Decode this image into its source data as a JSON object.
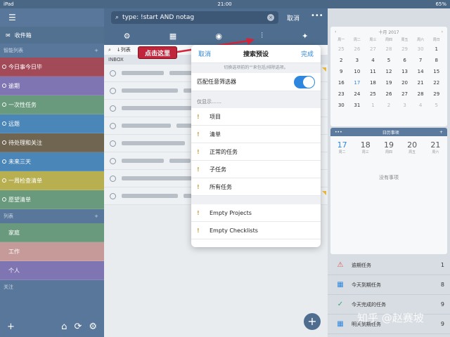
{
  "status": {
    "carrier": "iPad",
    "time": "21:00",
    "battery": "65%"
  },
  "sidebar": {
    "inbox_label": "收件箱",
    "smart_lists_title": "智能列表",
    "smart_lists": [
      {
        "label": "今日事今日毕",
        "color": "#a24a58"
      },
      {
        "label": "逾期",
        "color": "#7e75b2"
      },
      {
        "label": "一次性任务",
        "color": "#6a9a7d"
      },
      {
        "label": "远题",
        "color": "#4b86b8"
      },
      {
        "label": "待处理和关注",
        "color": "#6f6550"
      },
      {
        "label": "未来三天",
        "color": "#4b86b8"
      },
      {
        "label": "一周检查清单",
        "color": "#b8b050"
      },
      {
        "label": "愿望清单",
        "color": "#6a9a7d"
      }
    ],
    "lists_title": "列表",
    "lists": [
      {
        "label": "家庭",
        "color": "#6a9a7d"
      },
      {
        "label": "工作",
        "color": "#c79a9a"
      },
      {
        "label": "个人",
        "color": "#7e75b2"
      }
    ],
    "focus_title": "关注"
  },
  "search": {
    "query": "type: !start AND notag",
    "cancel_label": "取消"
  },
  "list": {
    "header_label": "↓列表",
    "inbox_label": "INBOX"
  },
  "callout": {
    "label": "点击这里"
  },
  "popover": {
    "cancel_label": "取消",
    "title": "搜索预设",
    "done_label": "完成",
    "hint": "切换选项前的\"\"来包括/排除选项。",
    "match_any_label": "匹配任意筛选器",
    "match_any_on": true,
    "show_only_title": "仅显示……",
    "options": [
      "项目",
      "清单",
      "正常的任务",
      "子任务",
      "所有任务"
    ],
    "empty_options": [
      "Empty Projects",
      "Empty Checklists"
    ]
  },
  "calendar": {
    "month_label": "十月 2017",
    "weekdays": [
      "周一",
      "周二",
      "周三",
      "周四",
      "周五",
      "周六",
      "周日"
    ],
    "rows": [
      [
        "25",
        "26",
        "27",
        "28",
        "29",
        "30",
        "1"
      ],
      [
        "2",
        "3",
        "4",
        "5",
        "6",
        "7",
        "8"
      ],
      [
        "9",
        "10",
        "11",
        "12",
        "13",
        "14",
        "15"
      ],
      [
        "16",
        "17",
        "18",
        "19",
        "20",
        "21",
        "22"
      ],
      [
        "23",
        "24",
        "25",
        "26",
        "27",
        "28",
        "29"
      ],
      [
        "30",
        "31",
        "1",
        "2",
        "3",
        "4",
        "5"
      ]
    ]
  },
  "week": {
    "title": "日历事项",
    "days": [
      {
        "num": "17",
        "wd": "周二"
      },
      {
        "num": "18",
        "wd": "周三"
      },
      {
        "num": "19",
        "wd": "周四"
      },
      {
        "num": "20",
        "wd": "周五"
      },
      {
        "num": "21",
        "wd": "周六"
      }
    ],
    "no_events": "没有事项"
  },
  "summary": [
    {
      "label": "逾期任务",
      "count": "1",
      "icon": "warning-icon"
    },
    {
      "label": "今天到期任务",
      "count": "8",
      "icon": "calendar-icon"
    },
    {
      "label": "今天完成的任务",
      "count": "9",
      "icon": "check-icon"
    },
    {
      "label": "明天到期任务",
      "count": "9",
      "icon": "calendar-icon"
    }
  ],
  "watermark": "知乎 @赵赛坡"
}
